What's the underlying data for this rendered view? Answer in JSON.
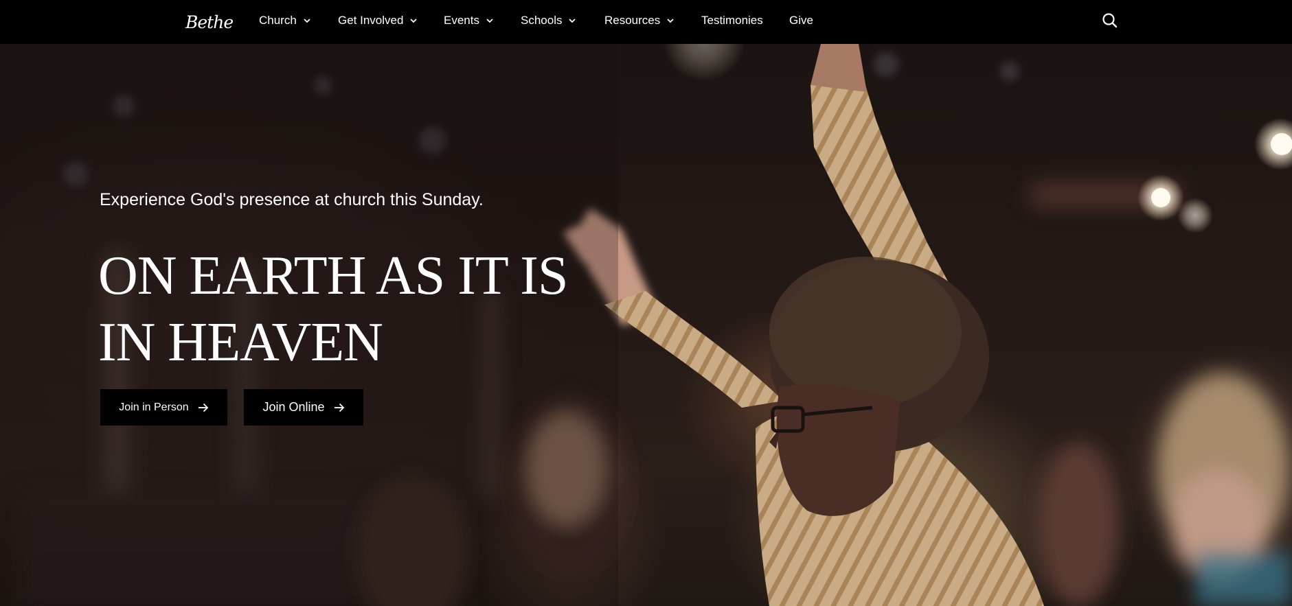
{
  "brand": {
    "logo_text": "Bethel"
  },
  "nav": {
    "items": [
      {
        "label": "Church",
        "dropdown": true
      },
      {
        "label": "Get Involved",
        "dropdown": true
      },
      {
        "label": "Events",
        "dropdown": true
      },
      {
        "label": "Schools",
        "dropdown": true
      },
      {
        "label": "Resources",
        "dropdown": true
      },
      {
        "label": "Testimonies",
        "dropdown": false
      },
      {
        "label": "Give",
        "dropdown": false
      }
    ],
    "search_icon": "search-icon"
  },
  "hero": {
    "tagline": "Experience God's presence at church this Sunday.",
    "title_line1": "ON EARTH AS IT IS",
    "title_line2": "IN HEAVEN",
    "buttons": [
      {
        "label": "Join in Person",
        "icon": "arrow-right-icon"
      },
      {
        "label": "Join Online",
        "icon": "arrow-right-icon"
      }
    ]
  },
  "colors": {
    "nav_background": "#000000",
    "button_background": "#000000",
    "text": "#ffffff"
  }
}
